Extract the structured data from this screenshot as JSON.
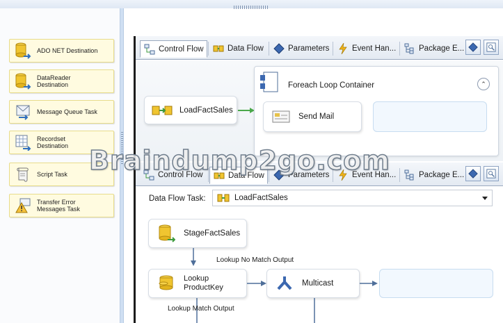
{
  "corner_mark": ")",
  "toolbox": {
    "items": [
      {
        "label": "ADO NET Destination",
        "icon": "ado-net-destination-icon"
      },
      {
        "label": "DataReader Destination",
        "icon": "datareader-destination-icon"
      },
      {
        "label": "Message Queue Task",
        "icon": "message-queue-task-icon"
      },
      {
        "label": "Recordset Destination",
        "icon": "recordset-destination-icon"
      },
      {
        "label": "Script Task",
        "icon": "script-task-icon"
      },
      {
        "label": "Transfer Error Messages Task",
        "icon": "transfer-error-messages-icon"
      }
    ]
  },
  "tabs": [
    {
      "label": "Control Flow",
      "icon": "control-flow-icon"
    },
    {
      "label": "Data Flow",
      "icon": "data-flow-icon"
    },
    {
      "label": "Parameters",
      "icon": "parameters-icon"
    },
    {
      "label": "Event Han...",
      "icon": "event-handlers-icon"
    },
    {
      "label": "Package E...",
      "icon": "package-explorer-icon"
    }
  ],
  "control_flow": {
    "active_tab": "Control Flow",
    "load_task": "LoadFactSales",
    "container_title": "Foreach Loop Container",
    "send_mail": "Send Mail"
  },
  "data_flow": {
    "active_tab": "Data Flow",
    "task_label": "Data Flow Task:",
    "task_selected": "LoadFactSales",
    "stage": "StageFactSales",
    "lookup": "Lookup ProductKey",
    "multicast": "Multicast",
    "no_match_output": "Lookup No Match Output",
    "match_output": "Lookup Match Output"
  },
  "watermark": "Braindump2go.com",
  "colors": {
    "toolbox_item_bg": "#fffbe0",
    "splitter": "#cfdff2",
    "arrow_green": "#4aa84a",
    "arrow_blue": "#4f6f9a"
  }
}
